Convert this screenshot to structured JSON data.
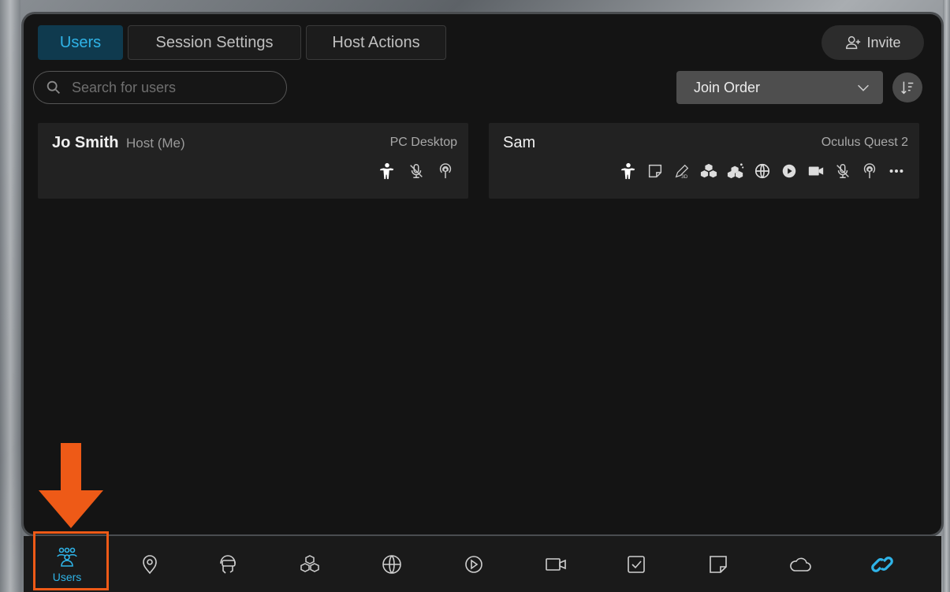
{
  "tabs": [
    {
      "label": "Users",
      "active": true
    },
    {
      "label": "Session Settings",
      "active": false
    },
    {
      "label": "Host Actions",
      "active": false
    }
  ],
  "invite_label": "Invite",
  "search": {
    "placeholder": "Search for users",
    "value": ""
  },
  "sort": {
    "selected": "Join Order"
  },
  "users": [
    {
      "name": "Jo Smith",
      "role": "Host (Me)",
      "device": "PC Desktop",
      "icons": [
        "avatar-icon",
        "mic-muted-icon",
        "broadcast-icon"
      ]
    },
    {
      "name": "Sam",
      "role": "",
      "device": "Oculus Quest 2",
      "icons": [
        "avatar-icon",
        "sticky-note-icon",
        "pen-3d-icon",
        "cubes-icon",
        "cubes-share-icon",
        "globe-icon",
        "play-icon",
        "video-icon",
        "mic-muted-icon",
        "broadcast-icon",
        "more-icon"
      ]
    }
  ],
  "bottom_nav": [
    {
      "icon": "users-icon",
      "label": "Users",
      "active": true
    },
    {
      "icon": "location-pin-icon",
      "label": "",
      "active": false
    },
    {
      "icon": "headset-icon",
      "label": "",
      "active": false
    },
    {
      "icon": "cubes-icon",
      "label": "",
      "active": false
    },
    {
      "icon": "globe-icon",
      "label": "",
      "active": false
    },
    {
      "icon": "play-icon",
      "label": "",
      "active": false
    },
    {
      "icon": "video-icon",
      "label": "",
      "active": false
    },
    {
      "icon": "checkbox-icon",
      "label": "",
      "active": false
    },
    {
      "icon": "sticky-note-icon",
      "label": "",
      "active": false
    },
    {
      "icon": "cloud-icon",
      "label": "",
      "active": false
    },
    {
      "icon": "link-icon",
      "label": "",
      "active": false
    }
  ],
  "colors": {
    "accent": "#2fb4e8",
    "highlight": "#ee5a17",
    "panel": "#141414",
    "card": "#222222"
  }
}
